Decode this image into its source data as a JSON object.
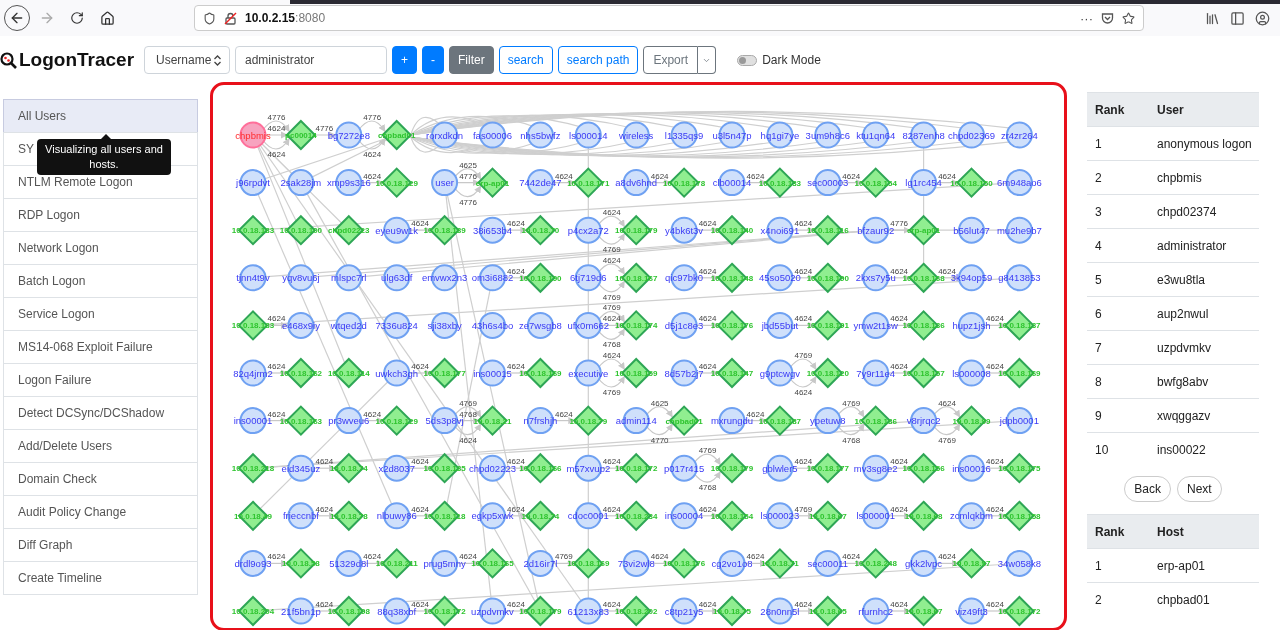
{
  "browser": {
    "url_host": "10.0.2.15",
    "url_port": ":8080",
    "more": "···"
  },
  "app": {
    "logo": "LogonTracer",
    "search_type": "Username",
    "search_value": "administrator",
    "buttons": [
      {
        "label": "+",
        "kind": "primary"
      },
      {
        "label": "-",
        "kind": "primary"
      },
      {
        "label": "Filter",
        "kind": "secondary"
      },
      {
        "label": "search",
        "kind": "outline"
      },
      {
        "label": "search path",
        "kind": "outline"
      }
    ],
    "export": "Export",
    "dark_mode": {
      "label": "Dark Mode",
      "on": false
    }
  },
  "sidebar": {
    "items": [
      {
        "label": "All Users",
        "selected": true
      },
      {
        "label": "SY",
        "selected": false
      },
      {
        "label": "NTLM Remote Logon",
        "selected": false
      },
      {
        "label": "RDP Logon",
        "selected": false
      },
      {
        "label": "Network Logon",
        "selected": false
      },
      {
        "label": "Batch Logon",
        "selected": false
      },
      {
        "label": "Service Logon",
        "selected": false
      },
      {
        "label": "MS14-068 Exploit Failure",
        "selected": false
      },
      {
        "label": "Logon Failure",
        "selected": false
      },
      {
        "label": "Detect DCSync/DCShadow",
        "selected": false
      },
      {
        "label": "Add/Delete Users",
        "selected": false
      },
      {
        "label": "Domain Check",
        "selected": false
      },
      {
        "label": "Audit Policy Change",
        "selected": false
      },
      {
        "label": "Diff Graph",
        "selected": false
      },
      {
        "label": "Create Timeline",
        "selected": false
      }
    ],
    "tooltip": "Visualizing all users and hosts."
  },
  "graph": {
    "rows": [
      [
        {
          "kind": "user",
          "label": "chpbmis",
          "selected": true,
          "edge": [
            "4624",
            "4776",
            "4624"
          ]
        },
        {
          "kind": "host",
          "label": "pc00014",
          "selected": false,
          "edge": [
            "4776"
          ]
        },
        {
          "kind": "user",
          "label": "bg7272e8",
          "selected": false,
          "edge": [
            "4776",
            "4624"
          ]
        },
        {
          "kind": "host",
          "label": "chpbad01",
          "selected": false
        },
        {
          "kind": "user",
          "label": "rorxdkdn",
          "selected": false
        },
        {
          "kind": "user",
          "label": "fas00006",
          "selected": false
        },
        {
          "kind": "user",
          "label": "nhs5bwfz",
          "selected": false
        },
        {
          "kind": "user",
          "label": "ls000014",
          "selected": false
        },
        {
          "kind": "user",
          "label": "wireless",
          "selected": false
        },
        {
          "kind": "user",
          "label": "l1335qs9",
          "selected": false
        },
        {
          "kind": "user",
          "label": "u3l5n47p",
          "selected": false
        },
        {
          "kind": "user",
          "label": "hq1gi7ye",
          "selected": false
        },
        {
          "kind": "user",
          "label": "3um9h8c6",
          "selected": false
        },
        {
          "kind": "user",
          "label": "ktu1qn64",
          "selected": false
        },
        {
          "kind": "user",
          "label": "8287enh8",
          "selected": false
        },
        {
          "kind": "user",
          "label": "chpd02369",
          "selected": false
        },
        {
          "kind": "user",
          "label": "zr4zr264",
          "selected": false
        }
      ],
      [
        {
          "kind": "user",
          "label": "j96rpdvt",
          "selected": false
        },
        {
          "kind": "user",
          "label": "2sak28jm",
          "selected": false
        },
        {
          "kind": "user",
          "label": "xmp9s316",
          "selected": false,
          "edge": [
            "4624"
          ]
        },
        {
          "kind": "host",
          "label": "10.0.18.129",
          "selected": false
        },
        {
          "kind": "user",
          "label": "user",
          "selected": false,
          "edge": [
            "4776",
            "4625",
            "4776"
          ]
        },
        {
          "kind": "host",
          "label": "erp-ap01",
          "selected": false
        },
        {
          "kind": "user",
          "label": "7442de47",
          "selected": false,
          "edge": [
            "4624"
          ]
        },
        {
          "kind": "host",
          "label": "10.0.18.171",
          "selected": false
        },
        {
          "kind": "user",
          "label": "a8dv6hnd",
          "selected": false,
          "edge": [
            "4624"
          ]
        },
        {
          "kind": "host",
          "label": "10.0.18.178",
          "selected": false
        },
        {
          "kind": "user",
          "label": "clb00014",
          "selected": false,
          "edge": [
            "4624"
          ]
        },
        {
          "kind": "host",
          "label": "10.0.18.133",
          "selected": false
        },
        {
          "kind": "user",
          "label": "sec00003",
          "selected": false,
          "edge": [
            "4624"
          ]
        },
        {
          "kind": "host",
          "label": "10.0.18.154",
          "selected": false
        },
        {
          "kind": "user",
          "label": "lg1rc454",
          "selected": false,
          "edge": [
            "4624"
          ]
        },
        {
          "kind": "host",
          "label": "10.0.18.150",
          "selected": false
        },
        {
          "kind": "user",
          "label": "6m948ao6",
          "selected": false
        }
      ],
      [
        {
          "kind": "host",
          "label": "10.0.18.183",
          "selected": false
        },
        {
          "kind": "host",
          "label": "10.0.18.100",
          "selected": false
        },
        {
          "kind": "host",
          "label": "chpd02223",
          "selected": false
        },
        {
          "kind": "user",
          "label": "eyeu9w1k",
          "selected": false,
          "edge": [
            "4624"
          ]
        },
        {
          "kind": "host",
          "label": "10.0.18.189",
          "selected": false
        },
        {
          "kind": "user",
          "label": "38i653b4",
          "selected": false,
          "edge": [
            "4624"
          ]
        },
        {
          "kind": "host",
          "label": "10.0.18.70",
          "selected": false
        },
        {
          "kind": "user",
          "label": "p4cx2a72",
          "selected": false,
          "edge": [
            "4624",
            "4769"
          ]
        },
        {
          "kind": "host",
          "label": "10.0.18.179",
          "selected": false
        },
        {
          "kind": "user",
          "label": "y4bk6t3v",
          "selected": false,
          "edge": [
            "4624"
          ]
        },
        {
          "kind": "host",
          "label": "10.0.18.140",
          "selected": false
        },
        {
          "kind": "user",
          "label": "x4noi691",
          "selected": false,
          "edge": [
            "4624"
          ]
        },
        {
          "kind": "host",
          "label": "10.0.18.116",
          "selected": false
        },
        {
          "kind": "user",
          "label": "bfzaur92",
          "selected": false,
          "edge": [
            "4776"
          ]
        },
        {
          "kind": "host",
          "label": "erp-ap01",
          "selected": false
        },
        {
          "kind": "user",
          "label": "b56lut47",
          "selected": false
        },
        {
          "kind": "user",
          "label": "mu2he9b7",
          "selected": false
        }
      ],
      [
        {
          "kind": "user",
          "label": "tjnn4t9v",
          "selected": false
        },
        {
          "kind": "user",
          "label": "yqv8vu6j",
          "selected": false
        },
        {
          "kind": "user",
          "label": "mlspc7rl",
          "selected": false
        },
        {
          "kind": "user",
          "label": "ulg63df",
          "selected": false
        },
        {
          "kind": "user",
          "label": "emvwx2n3",
          "selected": false
        },
        {
          "kind": "user",
          "label": "om3i6882",
          "selected": false,
          "edge": [
            "4624"
          ]
        },
        {
          "kind": "host",
          "label": "10.0.18.190",
          "selected": false
        },
        {
          "kind": "user",
          "label": "6tj719d6",
          "selected": false,
          "edge": [
            "4624",
            "4769"
          ]
        },
        {
          "kind": "host",
          "label": "10.0.18.167",
          "selected": false
        },
        {
          "kind": "user",
          "label": "qic97bk0",
          "selected": false,
          "edge": [
            "4624"
          ]
        },
        {
          "kind": "host",
          "label": "10.0.18.148",
          "selected": false
        },
        {
          "kind": "user",
          "label": "45so5020",
          "selected": false,
          "edge": [
            "4624"
          ]
        },
        {
          "kind": "host",
          "label": "10.0.18.190",
          "selected": false
        },
        {
          "kind": "user",
          "label": "2kxs7y5u",
          "selected": false,
          "edge": [
            "4624"
          ]
        },
        {
          "kind": "host",
          "label": "10.0.18.168",
          "selected": false,
          "edge": [
            "4624"
          ]
        },
        {
          "kind": "user",
          "label": "3k94op59",
          "selected": false
        },
        {
          "kind": "user",
          "label": "g8413853",
          "selected": false
        }
      ],
      [
        {
          "kind": "host",
          "label": "10.0.18.183",
          "selected": false,
          "edge": [
            "4624"
          ]
        },
        {
          "kind": "user",
          "label": "e468x9iy",
          "selected": false
        },
        {
          "kind": "user",
          "label": "wtqed2d",
          "selected": false
        },
        {
          "kind": "user",
          "label": "7336u824",
          "selected": false
        },
        {
          "kind": "user",
          "label": "sji38xby",
          "selected": false
        },
        {
          "kind": "user",
          "label": "43h6s4bo",
          "selected": false
        },
        {
          "kind": "user",
          "label": "ze7wsgb8",
          "selected": false
        },
        {
          "kind": "user",
          "label": "ufx0m662",
          "selected": false,
          "edge": [
            "4624",
            "4769",
            "4768"
          ]
        },
        {
          "kind": "host",
          "label": "10.0.18.174",
          "selected": false
        },
        {
          "kind": "user",
          "label": "d5j1c8e3",
          "selected": false,
          "edge": [
            "4624"
          ]
        },
        {
          "kind": "host",
          "label": "10.0.18.176",
          "selected": false
        },
        {
          "kind": "user",
          "label": "jbd55but",
          "selected": false,
          "edge": [
            "4624"
          ]
        },
        {
          "kind": "host",
          "label": "10.0.18.191",
          "selected": false
        },
        {
          "kind": "user",
          "label": "ymw2t1sw",
          "selected": false,
          "edge": [
            "4624"
          ]
        },
        {
          "kind": "host",
          "label": "10.0.18.136",
          "selected": false
        },
        {
          "kind": "user",
          "label": "hupz1jsh",
          "selected": false,
          "edge": [
            "4624"
          ]
        },
        {
          "kind": "host",
          "label": "10.0.18.137",
          "selected": false
        }
      ],
      [
        {
          "kind": "user",
          "label": "82q4jrm2",
          "selected": false,
          "edge": [
            "4624"
          ]
        },
        {
          "kind": "host",
          "label": "10.0.18.162",
          "selected": false
        },
        {
          "kind": "host",
          "label": "10.0.18.114",
          "selected": false
        },
        {
          "kind": "user",
          "label": "uwkch3gh",
          "selected": false,
          "edge": [
            "4624"
          ]
        },
        {
          "kind": "host",
          "label": "10.0.18.177",
          "selected": false
        },
        {
          "kind": "user",
          "label": "ins00015",
          "selected": false,
          "edge": [
            "4624"
          ]
        },
        {
          "kind": "host",
          "label": "10.0.18.169",
          "selected": false
        },
        {
          "kind": "user",
          "label": "executive",
          "selected": false,
          "edge": [
            "4624",
            "4769"
          ]
        },
        {
          "kind": "host",
          "label": "10.0.18.159",
          "selected": false
        },
        {
          "kind": "user",
          "label": "8d57b2j7",
          "selected": false,
          "edge": [
            "4624"
          ]
        },
        {
          "kind": "host",
          "label": "10.0.18.147",
          "selected": false
        },
        {
          "kind": "user",
          "label": "g9ptcwgv",
          "selected": false,
          "edge": [
            "4769",
            "4624"
          ]
        },
        {
          "kind": "host",
          "label": "10.0.18.120",
          "selected": false
        },
        {
          "kind": "user",
          "label": "7y9r11e4",
          "selected": false,
          "edge": [
            "4624"
          ]
        },
        {
          "kind": "host",
          "label": "10.0.18.157",
          "selected": false
        },
        {
          "kind": "user",
          "label": "ls000008",
          "selected": false,
          "edge": [
            "4624"
          ]
        },
        {
          "kind": "host",
          "label": "10.0.18.169",
          "selected": false
        }
      ],
      [
        {
          "kind": "user",
          "label": "ins00001",
          "selected": false,
          "edge": [
            "4624"
          ]
        },
        {
          "kind": "host",
          "label": "10.0.18.163",
          "selected": false
        },
        {
          "kind": "user",
          "label": "pr3wveu6",
          "selected": false,
          "edge": [
            "4624"
          ]
        },
        {
          "kind": "host",
          "label": "10.0.18.129",
          "selected": false
        },
        {
          "kind": "user",
          "label": "5ds3p8vj",
          "selected": false,
          "edge": [
            "4768",
            "4769",
            "4624"
          ]
        },
        {
          "kind": "host",
          "label": "10.0.18.21",
          "selected": false
        },
        {
          "kind": "user",
          "label": "n7frshjh",
          "selected": false,
          "edge": [
            "4624"
          ]
        },
        {
          "kind": "host",
          "label": "10.0.18.79",
          "selected": false
        },
        {
          "kind": "user",
          "label": "admin114",
          "selected": false,
          "edge": [
            "4625",
            "4770"
          ]
        },
        {
          "kind": "host",
          "label": "chpbad01",
          "selected": false
        },
        {
          "kind": "user",
          "label": "mxrungdu",
          "selected": false,
          "edge": [
            "4624"
          ]
        },
        {
          "kind": "host",
          "label": "10.0.18.187",
          "selected": false
        },
        {
          "kind": "user",
          "label": "ypetuw8",
          "selected": false,
          "edge": [
            "4769",
            "4768"
          ]
        },
        {
          "kind": "host",
          "label": "10.0.18.186",
          "selected": false
        },
        {
          "kind": "user",
          "label": "v8rjrqc2",
          "selected": false,
          "edge": [
            "4624",
            "4769"
          ]
        },
        {
          "kind": "host",
          "label": "10.0.18.99",
          "selected": false
        },
        {
          "kind": "user",
          "label": "jdpb0001",
          "selected": false
        }
      ],
      [
        {
          "kind": "host",
          "label": "10.0.18.218",
          "selected": false
        },
        {
          "kind": "user",
          "label": "eid345uz",
          "selected": false,
          "edge": [
            "4624"
          ]
        },
        {
          "kind": "host",
          "label": "10.0.18.74",
          "selected": false
        },
        {
          "kind": "user",
          "label": "x2d8037",
          "selected": false,
          "edge": [
            "4624"
          ]
        },
        {
          "kind": "host",
          "label": "10.0.18.185",
          "selected": false
        },
        {
          "kind": "user",
          "label": "chpd02223",
          "selected": false,
          "edge": [
            "4624"
          ]
        },
        {
          "kind": "host",
          "label": "10.0.18.166",
          "selected": false
        },
        {
          "kind": "user",
          "label": "m57xvup2",
          "selected": false,
          "edge": [
            "4624"
          ]
        },
        {
          "kind": "host",
          "label": "10.0.18.172",
          "selected": false
        },
        {
          "kind": "user",
          "label": "p017r415",
          "selected": false,
          "edge": [
            "4769",
            "4768"
          ]
        },
        {
          "kind": "host",
          "label": "10.0.18.179",
          "selected": false
        },
        {
          "kind": "user",
          "label": "gblwler5",
          "selected": false,
          "edge": [
            "4624"
          ]
        },
        {
          "kind": "host",
          "label": "10.0.18.177",
          "selected": false
        },
        {
          "kind": "user",
          "label": "mv3sg8e2",
          "selected": false,
          "edge": [
            "4624"
          ]
        },
        {
          "kind": "host",
          "label": "10.0.18.156",
          "selected": false
        },
        {
          "kind": "user",
          "label": "ins00016",
          "selected": false,
          "edge": [
            "4624"
          ]
        },
        {
          "kind": "host",
          "label": "10.0.18.175",
          "selected": false
        }
      ],
      [
        {
          "kind": "host",
          "label": "10.0.18.49",
          "selected": false
        },
        {
          "kind": "user",
          "label": "frieccnbf",
          "selected": false,
          "edge": [
            "4624"
          ]
        },
        {
          "kind": "host",
          "label": "10.0.18.78",
          "selected": false
        },
        {
          "kind": "user",
          "label": "nlbuwy86",
          "selected": false,
          "edge": [
            "4624"
          ]
        },
        {
          "kind": "host",
          "label": "10.0.18.118",
          "selected": false
        },
        {
          "kind": "user",
          "label": "egkp5xwk",
          "selected": false,
          "edge": [
            "4624"
          ]
        },
        {
          "kind": "host",
          "label": "10.0.18.74",
          "selected": false
        },
        {
          "kind": "user",
          "label": "cdoc0001",
          "selected": false,
          "edge": [
            "4624"
          ]
        },
        {
          "kind": "host",
          "label": "10.0.18.234",
          "selected": false
        },
        {
          "kind": "user",
          "label": "ins00004",
          "selected": false,
          "edge": [
            "4624"
          ]
        },
        {
          "kind": "host",
          "label": "10.0.18.154",
          "selected": false
        },
        {
          "kind": "user",
          "label": "ls000023",
          "selected": false,
          "edge": [
            "4769"
          ]
        },
        {
          "kind": "host",
          "label": "10.0.18.67",
          "selected": false
        },
        {
          "kind": "user",
          "label": "ls000001",
          "selected": false,
          "edge": [
            "4624"
          ]
        },
        {
          "kind": "host",
          "label": "10.0.18.68",
          "selected": false
        },
        {
          "kind": "user",
          "label": "zcmlqkbm",
          "selected": false,
          "edge": [
            "4624"
          ]
        },
        {
          "kind": "host",
          "label": "10.0.18.158",
          "selected": false
        }
      ],
      [
        {
          "kind": "user",
          "label": "drdl9o93",
          "selected": false,
          "edge": [
            "4624"
          ]
        },
        {
          "kind": "host",
          "label": "10.0.18.58",
          "selected": false
        },
        {
          "kind": "user",
          "label": "51329d8l",
          "selected": false,
          "edge": [
            "4624"
          ]
        },
        {
          "kind": "host",
          "label": "10.0.18.211",
          "selected": false
        },
        {
          "kind": "user",
          "label": "prug5mny",
          "selected": false,
          "edge": [
            "4624"
          ]
        },
        {
          "kind": "host",
          "label": "10.0.18.165",
          "selected": false
        },
        {
          "kind": "user",
          "label": "2d16ir7l",
          "selected": false,
          "edge": [
            "4769"
          ]
        },
        {
          "kind": "host",
          "label": "10.0.18.169",
          "selected": false
        },
        {
          "kind": "user",
          "label": "73vi2wl8",
          "selected": false,
          "edge": [
            "4624"
          ]
        },
        {
          "kind": "host",
          "label": "10.0.18.176",
          "selected": false
        },
        {
          "kind": "user",
          "label": "cg2vo1o8",
          "selected": false,
          "edge": [
            "4624"
          ]
        },
        {
          "kind": "host",
          "label": "10.0.18.71",
          "selected": false
        },
        {
          "kind": "user",
          "label": "sec00011",
          "selected": false,
          "edge": [
            "4624"
          ]
        },
        {
          "kind": "host",
          "label": "10.0.18.248",
          "selected": false
        },
        {
          "kind": "user",
          "label": "gkk2lvpc",
          "selected": false,
          "edge": [
            "4624"
          ]
        },
        {
          "kind": "host",
          "label": "10.0.18.97",
          "selected": false
        },
        {
          "kind": "user",
          "label": "34w058k8",
          "selected": false
        }
      ],
      [
        {
          "kind": "host",
          "label": "10.0.18.204",
          "selected": false
        },
        {
          "kind": "user",
          "label": "21f5bn1p",
          "selected": false,
          "edge": [
            "4624"
          ]
        },
        {
          "kind": "host",
          "label": "10.0.18.198",
          "selected": false
        },
        {
          "kind": "user",
          "label": "88q38xbf",
          "selected": false,
          "edge": [
            "4624"
          ]
        },
        {
          "kind": "host",
          "label": "10.0.18.172",
          "selected": false
        },
        {
          "kind": "user",
          "label": "uzpdvmkv",
          "selected": false,
          "edge": [
            "4624"
          ]
        },
        {
          "kind": "host",
          "label": "10.0.18.179",
          "selected": false
        },
        {
          "kind": "user",
          "label": "61213x83",
          "selected": false,
          "edge": [
            "4624"
          ]
        },
        {
          "kind": "host",
          "label": "10.0.18.202",
          "selected": false
        },
        {
          "kind": "user",
          "label": "c8tp21y5",
          "selected": false,
          "edge": [
            "4624"
          ]
        },
        {
          "kind": "host",
          "label": "10.0.18.75",
          "selected": false
        },
        {
          "kind": "user",
          "label": "28n0nn5l",
          "selected": false,
          "edge": [
            "4624"
          ]
        },
        {
          "kind": "host",
          "label": "10.0.18.65",
          "selected": false
        },
        {
          "kind": "user",
          "label": "rfurnhc2",
          "selected": false,
          "edge": [
            "4624"
          ]
        },
        {
          "kind": "host",
          "label": "10.0.18.67",
          "selected": false
        },
        {
          "kind": "user",
          "label": "viz49ft3",
          "selected": false,
          "edge": [
            "4624"
          ]
        },
        {
          "kind": "host",
          "label": "10.0.18.172",
          "selected": false
        }
      ]
    ]
  },
  "user_ranking": {
    "columns": [
      "Rank",
      "User"
    ],
    "rows": [
      [
        "1",
        "anonymous logon"
      ],
      [
        "2",
        "chpbmis"
      ],
      [
        "3",
        "chpd02374"
      ],
      [
        "4",
        "administrator"
      ],
      [
        "5",
        "e3wu8tla"
      ],
      [
        "6",
        "aup2nwul"
      ],
      [
        "7",
        "uzpdvmkv"
      ],
      [
        "8",
        "bwfg8abv"
      ],
      [
        "9",
        "xwqggazv"
      ],
      [
        "10",
        "ins00022"
      ]
    ]
  },
  "pager": [
    "Back",
    "Next"
  ],
  "host_ranking": {
    "columns": [
      "Rank",
      "Host"
    ],
    "rows": [
      [
        "1",
        "erp-ap01"
      ],
      [
        "2",
        "chpbad01"
      ]
    ]
  }
}
